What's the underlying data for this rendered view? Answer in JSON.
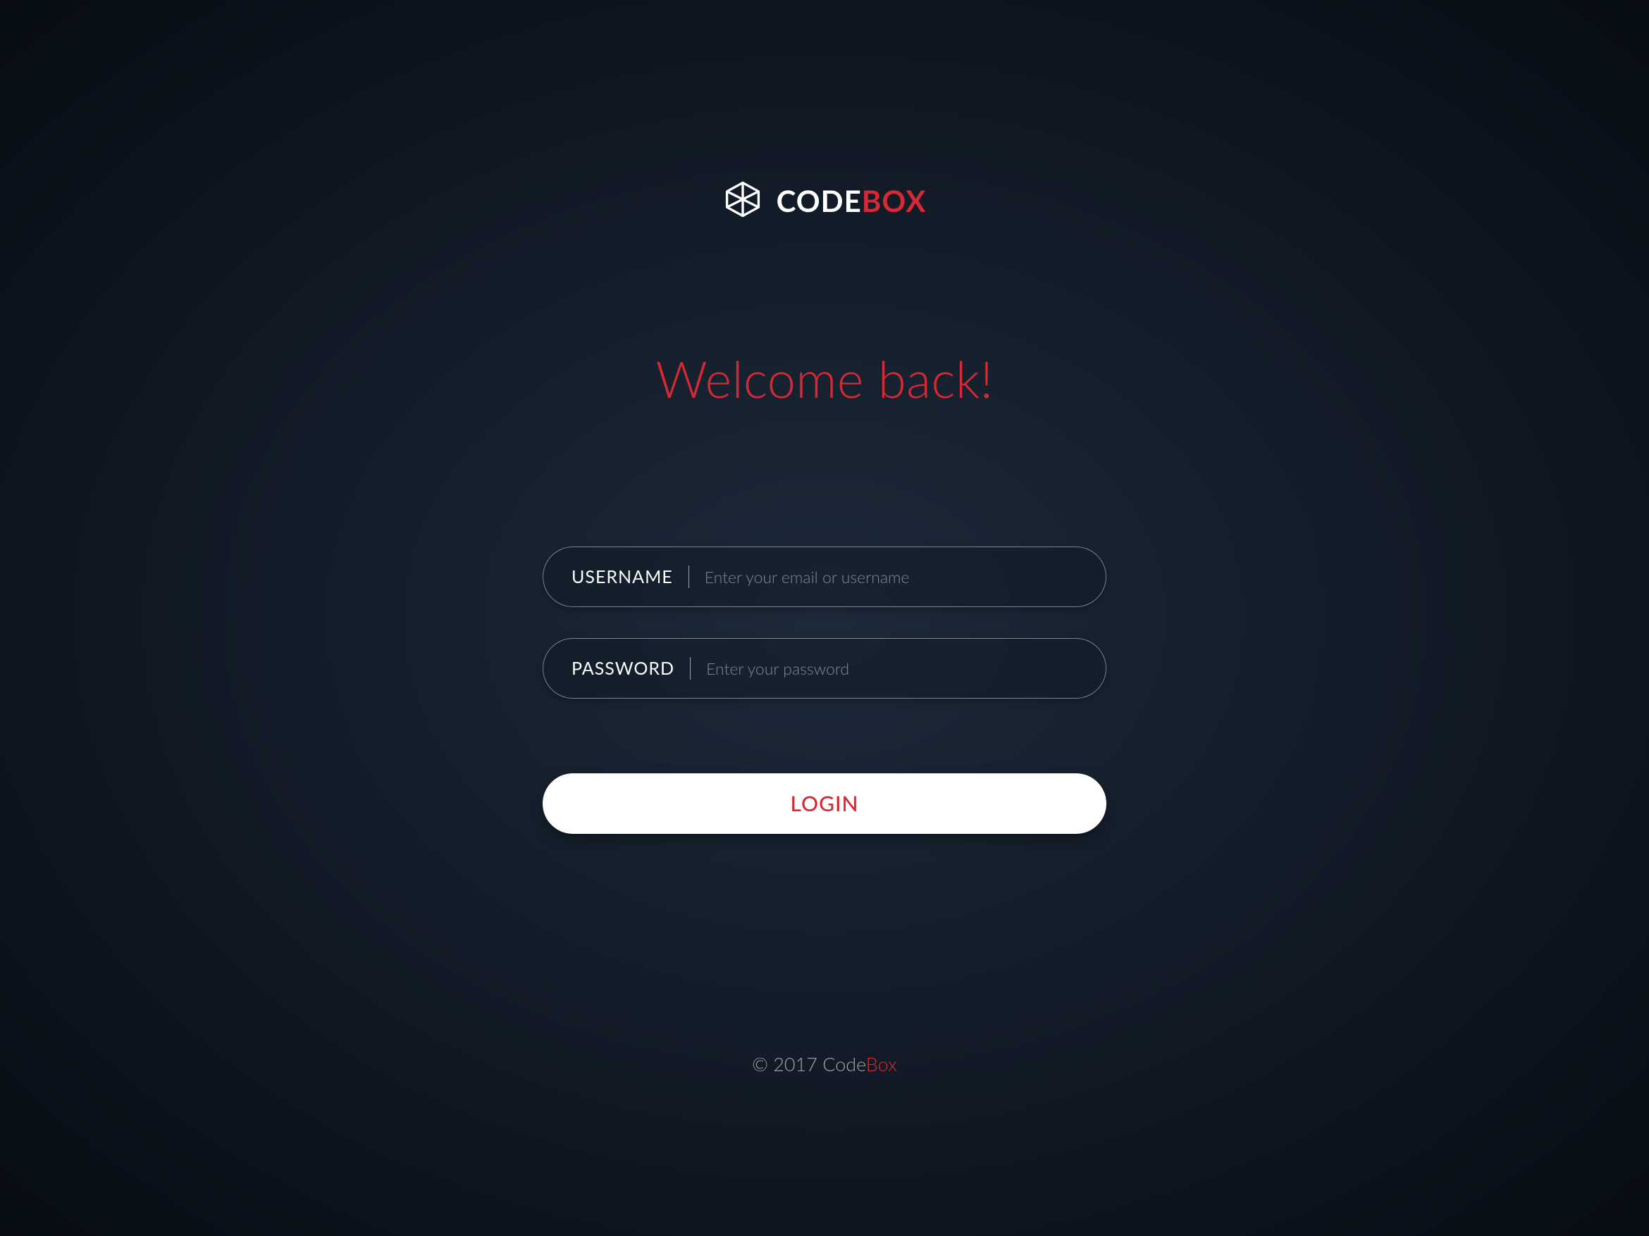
{
  "brand": {
    "name_part1": "CODE",
    "name_part2": "BOX"
  },
  "heading": "Welcome back!",
  "form": {
    "username": {
      "label": "USERNAME",
      "placeholder": "Enter your email or username",
      "value": ""
    },
    "password": {
      "label": "PASSWORD",
      "placeholder": "Enter your password",
      "value": ""
    },
    "submit_label": "LOGIN"
  },
  "footer": {
    "copyright_prefix": "© 2017 ",
    "brand_part1": "Code",
    "brand_part2": "Box"
  }
}
